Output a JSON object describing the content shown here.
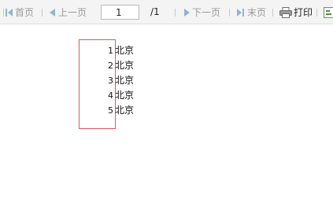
{
  "toolbar": {
    "first_label": "首页",
    "prev_label": "上一页",
    "page_value": "1",
    "page_total": "/1",
    "next_label": "下一页",
    "last_label": "末页",
    "print_label": "打印",
    "icons": [
      "first-page-icon",
      "prev-page-icon",
      "next-page-icon",
      "last-page-icon",
      "print-icon",
      "export-icon"
    ]
  },
  "report": {
    "rows": [
      {
        "num": "1",
        "city": "北京"
      },
      {
        "num": "2",
        "city": "北京"
      },
      {
        "num": "3",
        "city": "北京"
      },
      {
        "num": "4",
        "city": "北京"
      },
      {
        "num": "5",
        "city": "北京"
      }
    ]
  },
  "colors": {
    "toolbar_bg": "#f4f4f4",
    "disabled_text": "#9a9a9a",
    "arrow_blue": "#8fb4d8",
    "frame_red": "#e0575b"
  }
}
